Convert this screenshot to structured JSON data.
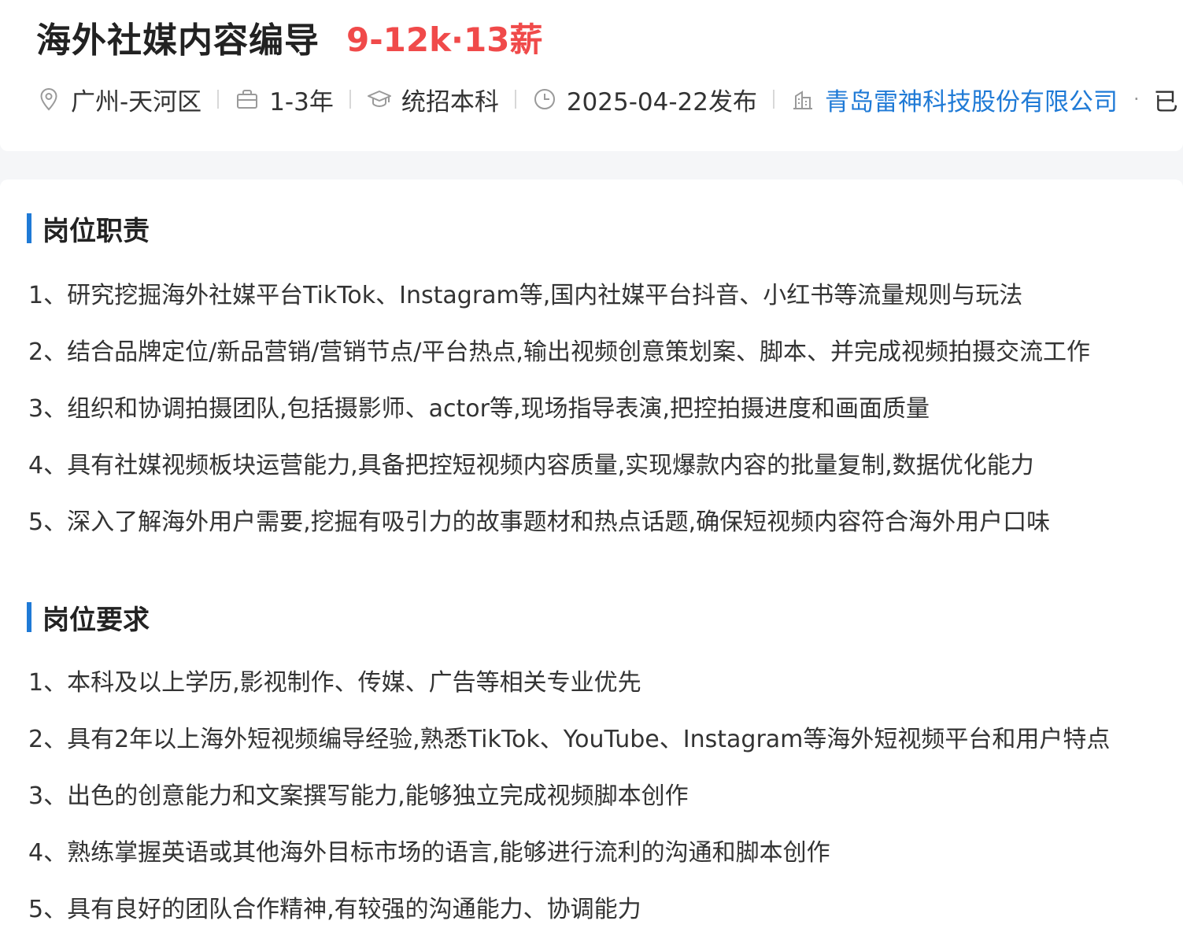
{
  "header": {
    "title": "海外社媒内容编导",
    "salary": "9-12k·13薪",
    "meta": {
      "location": "广州-天河区",
      "experience": "1-3年",
      "education": "统招本科",
      "published": "2025-04-22发布",
      "company": "青岛雷神科技股份有限公司",
      "dot": "·",
      "more": "已"
    }
  },
  "duties": {
    "title": "岗位职责",
    "items": [
      "1、研究挖掘海外社媒平台TikTok、Instagram等,国内社媒平台抖音、小红书等流量规则与玩法",
      "2、结合品牌定位/新品营销/营销节点/平台热点,输出视频创意策划案、脚本、并完成视频拍摄交流工作",
      "3、组织和协调拍摄团队,包括摄影师、actor等,现场指导表演,把控拍摄进度和画面质量",
      "4、具有社媒视频板块运营能力,具备把控短视频内容质量,实现爆款内容的批量复制,数据优化能力",
      "5、深入了解海外用户需要,挖掘有吸引力的故事题材和热点话题,确保短视频内容符合海外用户口味"
    ]
  },
  "requirements": {
    "title": "岗位要求",
    "items": [
      "1、本科及以上学历,影视制作、传媒、广告等相关专业优先",
      "2、具有2年以上海外短视频编导经验,熟悉TikTok、YouTube、Instagram等海外短视频平台和用户特点",
      "3、出色的创意能力和文案撰写能力,能够独立完成视频脚本创作",
      "4、熟练掌握英语或其他海外目标市场的语言,能够进行流利的沟通和脚本创作",
      "5、具有良好的团队合作精神,有较强的沟通能力、协调能力"
    ]
  },
  "colors": {
    "salary": "#f04a4a",
    "accent": "#1f7ad6",
    "background": "#f5f6f8"
  },
  "icons": [
    "location-pin-icon",
    "briefcase-icon",
    "graduation-cap-icon",
    "clock-icon",
    "building-icon"
  ]
}
